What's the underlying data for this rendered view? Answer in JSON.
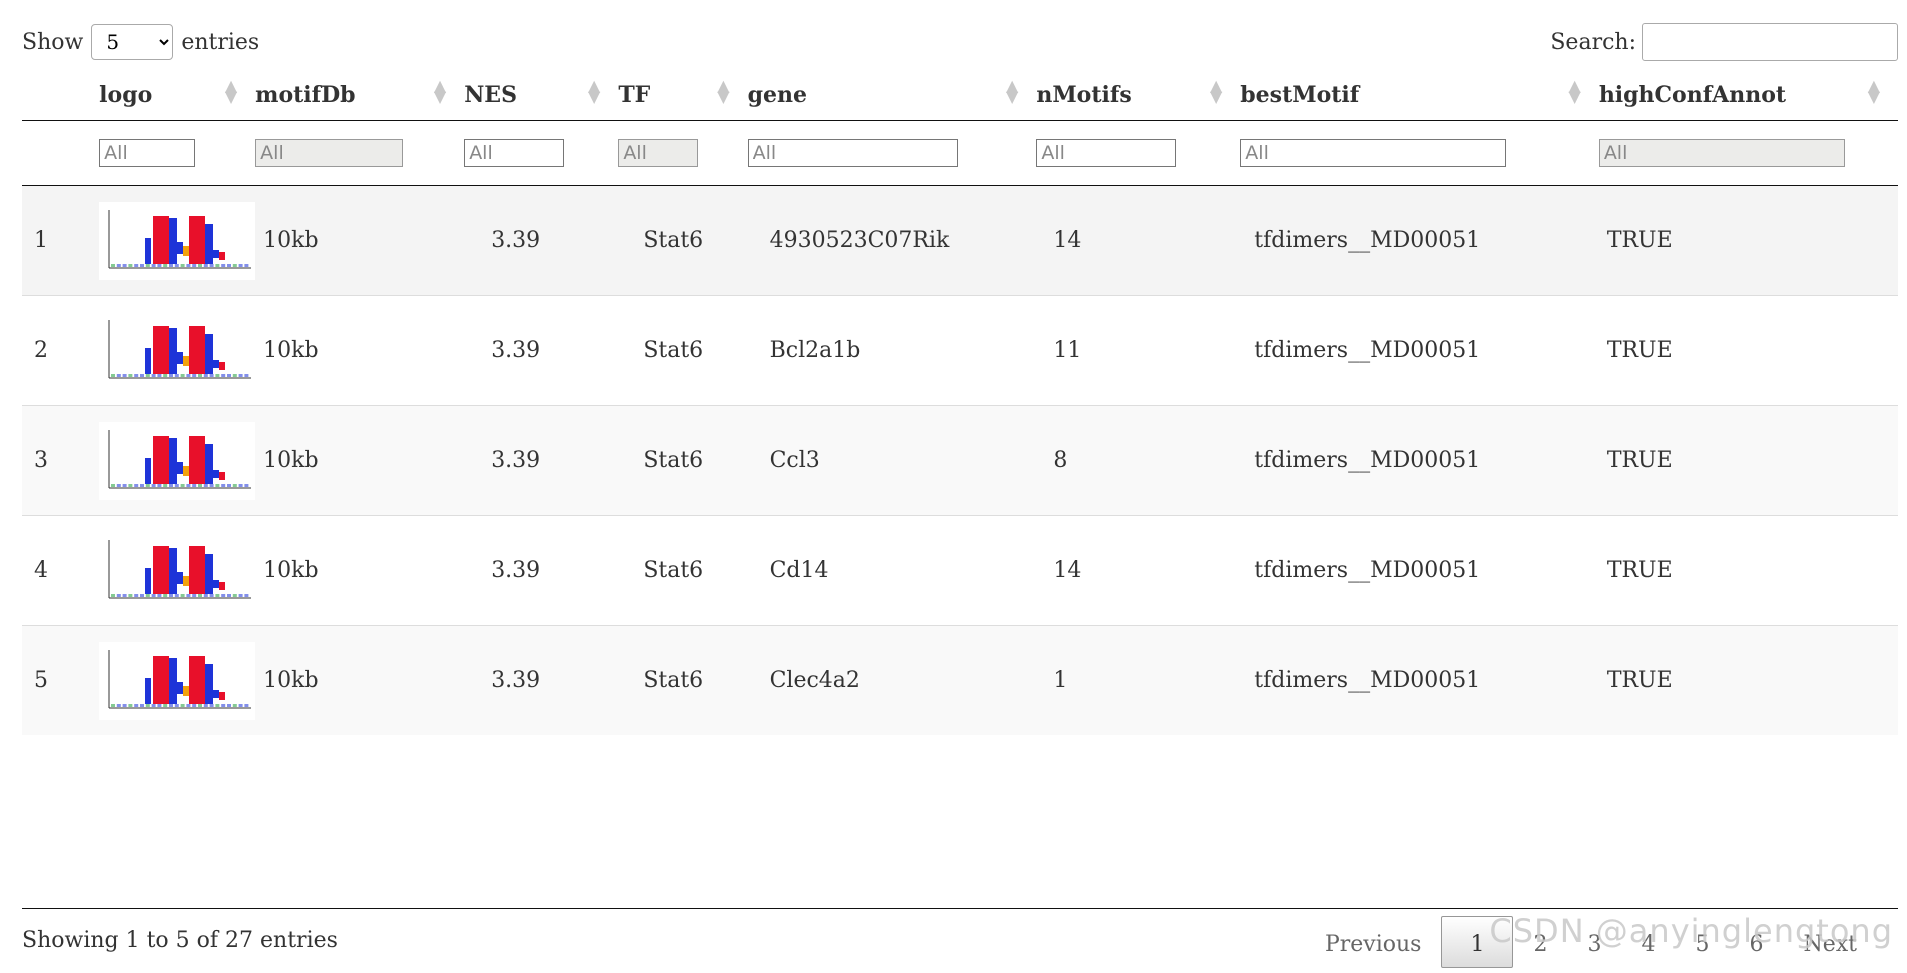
{
  "length_control": {
    "show": "Show",
    "entries": "entries",
    "selected": "5"
  },
  "search": {
    "label": "Search:",
    "value": ""
  },
  "columns": [
    {
      "key": "index",
      "label": ""
    },
    {
      "key": "logo",
      "label": "logo",
      "filter": "All",
      "filter_disabled": false
    },
    {
      "key": "motifDb",
      "label": "motifDb",
      "filter": "All",
      "filter_disabled": true
    },
    {
      "key": "NES",
      "label": "NES",
      "filter": "All",
      "filter_disabled": false
    },
    {
      "key": "TF",
      "label": "TF",
      "filter": "All",
      "filter_disabled": true
    },
    {
      "key": "gene",
      "label": "gene",
      "filter": "All",
      "filter_disabled": false
    },
    {
      "key": "nMotifs",
      "label": "nMotifs",
      "filter": "All",
      "filter_disabled": false
    },
    {
      "key": "bestMotif",
      "label": "bestMotif",
      "filter": "All",
      "filter_disabled": false
    },
    {
      "key": "highConfAnnot",
      "label": "highConfAnnot",
      "filter": "All",
      "filter_disabled": true
    }
  ],
  "rows": [
    {
      "index": "1",
      "logo": "sequence-logo-image",
      "motifDb": "10kb",
      "NES": "3.39",
      "TF": "Stat6",
      "gene": "4930523C07Rik",
      "nMotifs": "14",
      "bestMotif": "tfdimers__MD00051",
      "highConfAnnot": "TRUE"
    },
    {
      "index": "2",
      "logo": "sequence-logo-image",
      "motifDb": "10kb",
      "NES": "3.39",
      "TF": "Stat6",
      "gene": "Bcl2a1b",
      "nMotifs": "11",
      "bestMotif": "tfdimers__MD00051",
      "highConfAnnot": "TRUE"
    },
    {
      "index": "3",
      "logo": "sequence-logo-image",
      "motifDb": "10kb",
      "NES": "3.39",
      "TF": "Stat6",
      "gene": "Ccl3",
      "nMotifs": "8",
      "bestMotif": "tfdimers__MD00051",
      "highConfAnnot": "TRUE"
    },
    {
      "index": "4",
      "logo": "sequence-logo-image",
      "motifDb": "10kb",
      "NES": "3.39",
      "TF": "Stat6",
      "gene": "Cd14",
      "nMotifs": "14",
      "bestMotif": "tfdimers__MD00051",
      "highConfAnnot": "TRUE"
    },
    {
      "index": "5",
      "logo": "sequence-logo-image",
      "motifDb": "10kb",
      "NES": "3.39",
      "TF": "Stat6",
      "gene": "Clec4a2",
      "nMotifs": "1",
      "bestMotif": "tfdimers__MD00051",
      "highConfAnnot": "TRUE"
    }
  ],
  "footer": {
    "info": "Showing 1 to 5 of 27 entries",
    "previous": "Previous",
    "pages": [
      "1",
      "2",
      "3",
      "4",
      "5",
      "6"
    ],
    "current_page": "1",
    "next": "Next"
  },
  "watermark": "CSDN @anyinglengtong",
  "colors": {
    "logo_red": "#e8102a",
    "logo_blue": "#1e33d8",
    "logo_orange": "#f2a20c",
    "logo_green": "#1f9e3b"
  }
}
